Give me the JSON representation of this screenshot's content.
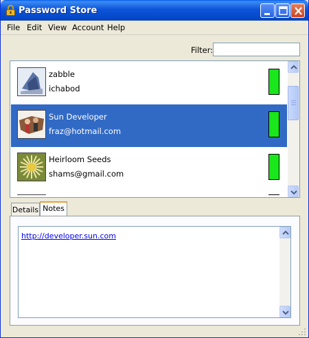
{
  "window": {
    "title": "Password Store"
  },
  "menu": [
    "File",
    "Edit",
    "View",
    "Account",
    "Help"
  ],
  "filter": {
    "label": "Filter:",
    "value": ""
  },
  "entries": [
    {
      "name": "zabble",
      "user": "ichabod",
      "thumbnail": "abstract-blue-image",
      "strength_color": "#19e61b",
      "selected": false
    },
    {
      "name": "Sun Developer",
      "user": "fraz@hotmail.com",
      "thumbnail": "people-photo",
      "strength_color": "#19e61b",
      "selected": true
    },
    {
      "name": "Heirloom Seeds",
      "user": "shams@gmail.com",
      "thumbnail": "flower-photo",
      "strength_color": "#19e61b",
      "selected": false
    }
  ],
  "tabs": {
    "details": "Details",
    "notes": "Notes",
    "active": "Notes"
  },
  "notes": {
    "text": "http://developer.sun.com"
  },
  "colors": {
    "titlebar": "#0a5fe8",
    "selection": "#316ac5",
    "strength": "#19e61b",
    "active_tab_accent": "#e8a33a"
  }
}
